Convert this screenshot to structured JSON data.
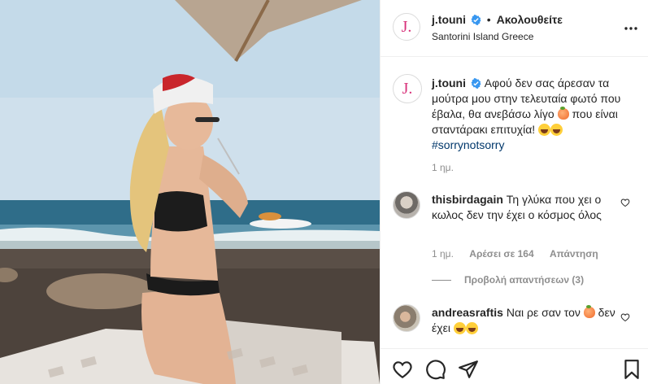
{
  "post": {
    "account": {
      "username": "j.touni",
      "avatar_letter": "J.",
      "verified": true
    },
    "follow_separator": "•",
    "follow_label": "Ακολουθείτε",
    "location": "Santorini Island Greece",
    "more_icon": "three-dots-icon"
  },
  "caption": {
    "username": "j.touni",
    "text_part1": "Αφού δεν σας άρεσαν τα μούτρα μου στην τελευταία φωτό που έβαλα, θα ανεβάσω λίγο",
    "text_part2": "που είναι σταντάρακι επιτυχία!",
    "hashtag": "#sorrynotsorry",
    "time": "1 ημ."
  },
  "comments": [
    {
      "username": "thisbirdagain",
      "text": "Τη γλύκα που χει ο κωλος δεν την έχει ο κόσμος όλος",
      "time": "1 ημ.",
      "likes": "Αρέσει σε 164",
      "reply_label": "Απάντηση",
      "view_replies": "Προβολή απαντήσεων (3)"
    },
    {
      "username": "andreasraftis",
      "text_part1": "Ναι ρε σαν τον",
      "text_part2": "δεν έχει"
    }
  ],
  "actions": {
    "like_icon": "heart-icon",
    "comment_icon": "comment-icon",
    "share_icon": "paper-plane-icon",
    "save_icon": "bookmark-icon"
  },
  "colors": {
    "brand_pink": "#d8327a",
    "verified_blue": "#3897f0",
    "hashtag": "#00376b",
    "muted": "#8e8e8e"
  }
}
